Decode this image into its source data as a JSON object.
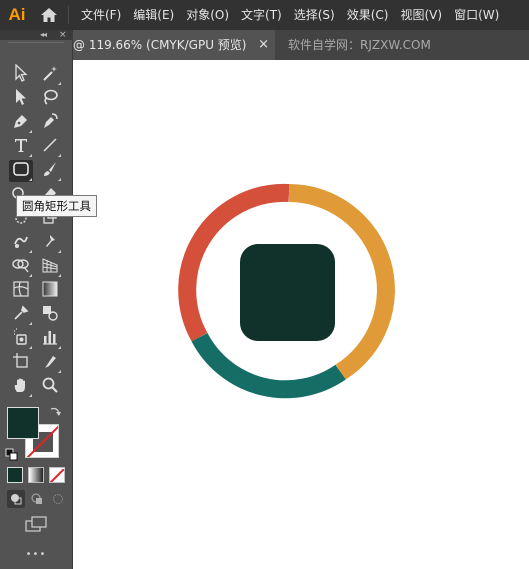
{
  "app": {
    "logo": "Ai"
  },
  "menu": [
    "文件(F)",
    "编辑(E)",
    "对象(O)",
    "文字(T)",
    "选择(S)",
    "效果(C)",
    "视图(V)",
    "窗口(W)"
  ],
  "document_tab": {
    "title": "@ 119.66% (CMYK/GPU 预览)",
    "close": "×"
  },
  "watermark": "软件自学网：RJZXW.COM",
  "tooltip": "圆角矩形工具",
  "toolbar": {
    "collapse": "◂◂",
    "close": "×",
    "more": "•••"
  },
  "icons": [
    "selection-tool-icon",
    "magic-wand-icon",
    "direct-selection-icon",
    "lasso-icon",
    "pen-icon",
    "curvature-icon",
    "type-icon",
    "line-segment-icon",
    "rounded-rectangle-icon",
    "paintbrush-icon",
    "shaper-icon",
    "eraser-icon",
    "rotate-icon",
    "scale-icon",
    "warp-icon",
    "puppet-warp-icon",
    "shape-builder-icon",
    "perspective-grid-icon",
    "mesh-icon",
    "gradient-icon",
    "eyedropper-icon",
    "blend-icon",
    "symbol-sprayer-icon",
    "column-graph-icon",
    "artboard-icon",
    "slice-icon",
    "hand-icon",
    "zoom-icon"
  ],
  "colors": {
    "fill": "#10322a",
    "ring_red": "#d4503a",
    "ring_orange": "#e09a38",
    "ring_teal": "#166d65",
    "shape": "#10322a",
    "ai_orange": "#ff9a00"
  }
}
